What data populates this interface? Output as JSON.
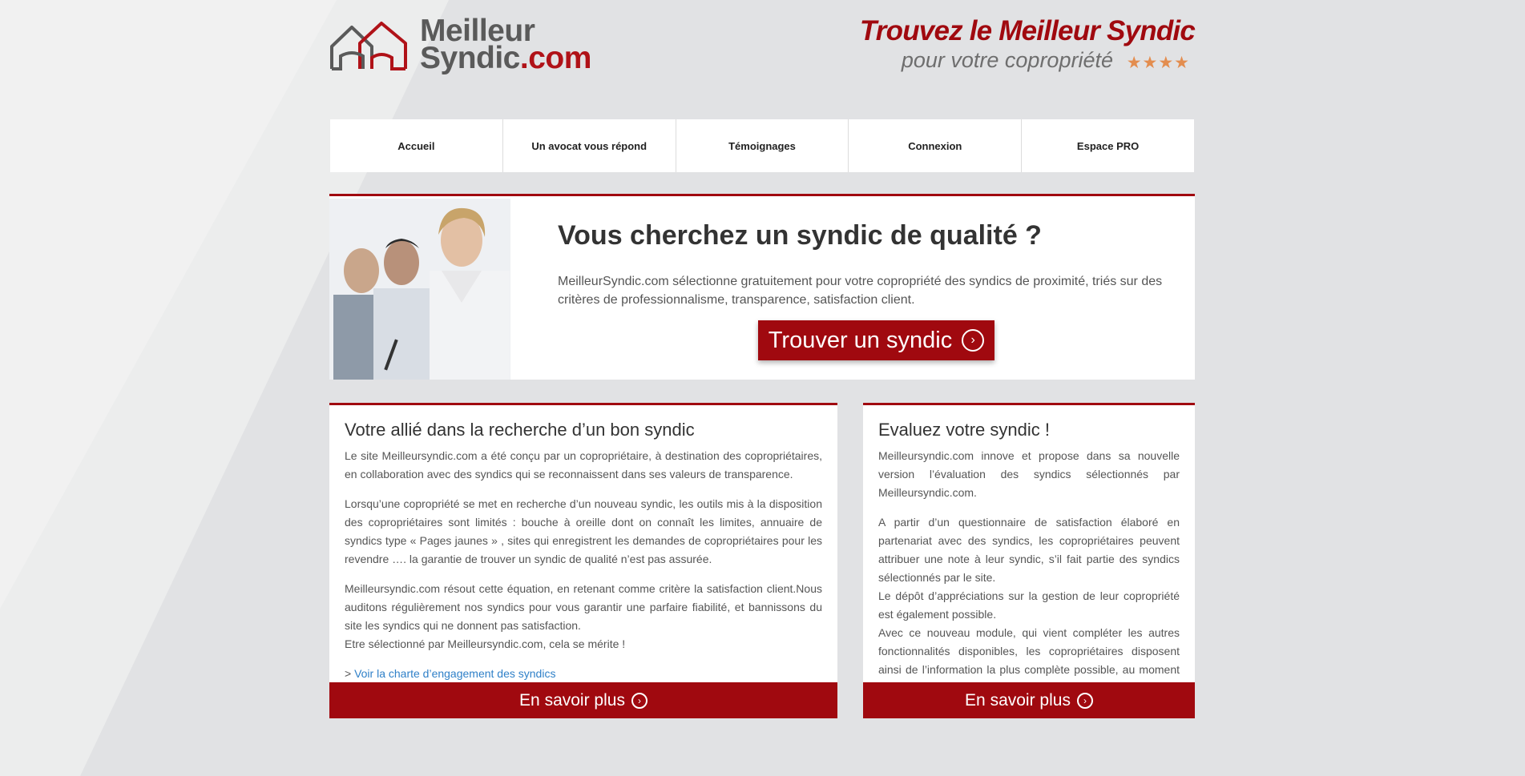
{
  "header": {
    "logo_line1": "Meilleur",
    "logo_line2_a": "Syndic",
    "logo_line2_b": ".com",
    "tagline_1": "Trouvez le Meilleur Syndic",
    "tagline_2": "pour votre copropriété",
    "stars": "★★★★"
  },
  "nav": {
    "items": [
      {
        "label": "Accueil"
      },
      {
        "label": "Un avocat vous répond"
      },
      {
        "label": "Témoignages"
      },
      {
        "label": "Connexion"
      },
      {
        "label": "Espace PRO"
      }
    ]
  },
  "hero": {
    "title": "Vous cherchez un syndic de qualité ?",
    "text": "MeilleurSyndic.com sélectionne gratuitement pour votre copropriété des syndics de proximité, triés sur des critères de professionnalisme, transparence, satisfaction client.",
    "button_label": "Trouver un syndic"
  },
  "left_card": {
    "title": "Votre allié dans la recherche d’un bon syndic",
    "p1": "Le site Meilleursyndic.com a été conçu par un copropriétaire, à destination des copropriétaires, en collaboration avec des syndics qui se reconnaissent dans ses valeurs de transparence.",
    "p2": "Lorsqu’une copropriété se met en recherche d’un nouveau syndic, les outils mis à la disposition des copropriétaires sont limités : bouche à oreille dont on connaît les limites, annuaire de syndics type « Pages jaunes » , sites qui enregistrent les demandes de copropriétaires pour les revendre …. la garantie de trouver un syndic de qualité n’est pas assurée.",
    "p3": "Meilleursyndic.com résout cette équation, en retenant comme critère la satisfaction client.Nous auditons régulièrement nos syndics pour vous garantir une parfaire fiabilité, et bannissons du site les syndics qui ne donnent pas satisfaction.",
    "p4": "Etre sélectionné par Meilleursyndic.com, cela se mérite !",
    "link_prefix": ">",
    "link_label": "Voir la charte d’engagement des syndics",
    "button_label": "En savoir plus"
  },
  "right_card": {
    "title": "Evaluez votre syndic !",
    "p1": "Meilleursyndic.com innove et propose dans sa nouvelle version l’évaluation des syndics sélectionnés par Meilleursyndic.com.",
    "p2": "A partir d’un questionnaire de satisfaction élaboré en partenariat avec des syndics, les copropriétaires peuvent attribuer une note à leur syndic, s’il fait partie des syndics sélectionnés par le site.",
    "p3": "Le dépôt d’appréciations  sur la gestion de leur copropriété est également possible.",
    "p4": "Avec ce nouveau module, qui vient compléter les autres fonctionnalités disponibles, les copropriétaires disposent ainsi de l’information la plus complète possible, au moment de choisir entre plusieurs cabinets de syndics sélectionnés par Meilleursyndic.com.",
    "button_label": "En savoir plus"
  },
  "colors": {
    "brand_red": "#a0090f",
    "background": "#e1e2e4",
    "link_blue": "#2f80c8",
    "star_orange": "#e38d4f"
  }
}
